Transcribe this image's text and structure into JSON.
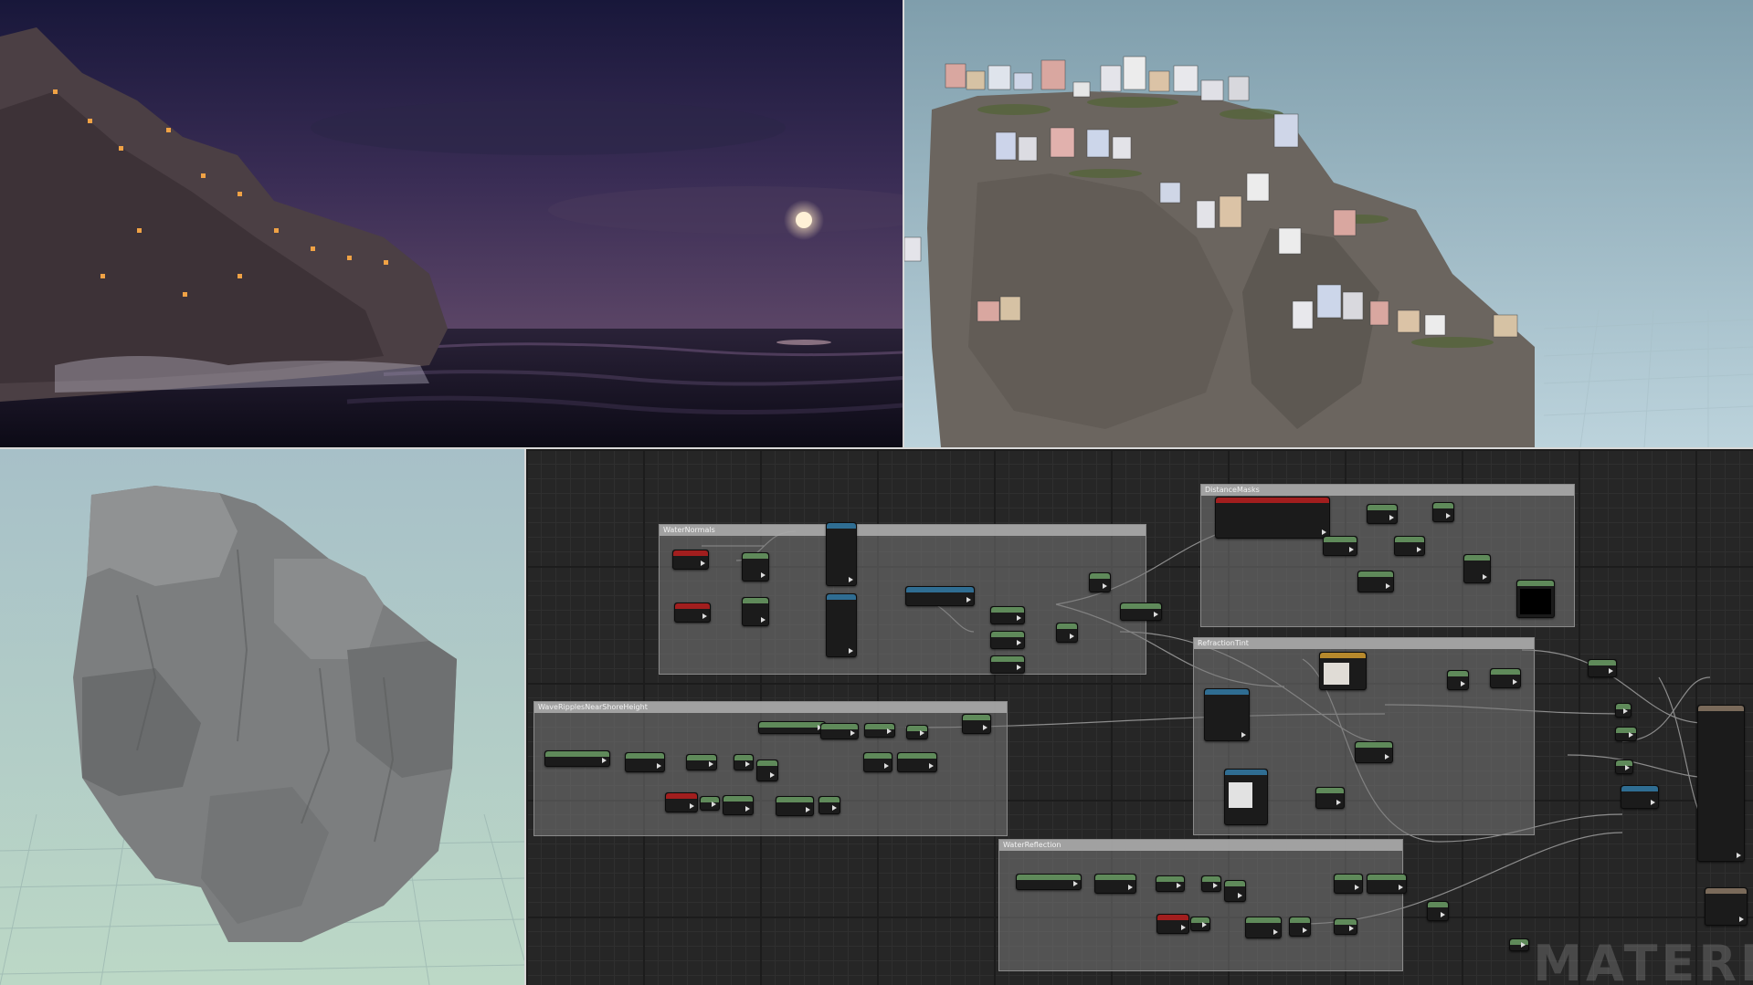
{
  "panels": {
    "night_render": {
      "label": "Night coastal cliff render"
    },
    "day_render": {
      "label": "Cliff with houses viewport"
    },
    "rock_mesh": {
      "label": "Sculpted rock mesh viewport"
    },
    "material_graph": {
      "label": "Material node graph"
    }
  },
  "graph": {
    "comments": [
      {
        "title": "WaterNormals"
      },
      {
        "title": "DistanceMasks"
      },
      {
        "title": "WaveRipplesNearShoreHeight"
      },
      {
        "title": "RefractionTint"
      },
      {
        "title": "WaterReflection"
      }
    ],
    "watermark": "MATERI"
  },
  "colors": {
    "graph_bg": "#262626",
    "node_green": "#5f8a5a",
    "node_red": "#a21e1e",
    "node_blue": "#2f6d92",
    "node_orange": "#b7892c"
  }
}
